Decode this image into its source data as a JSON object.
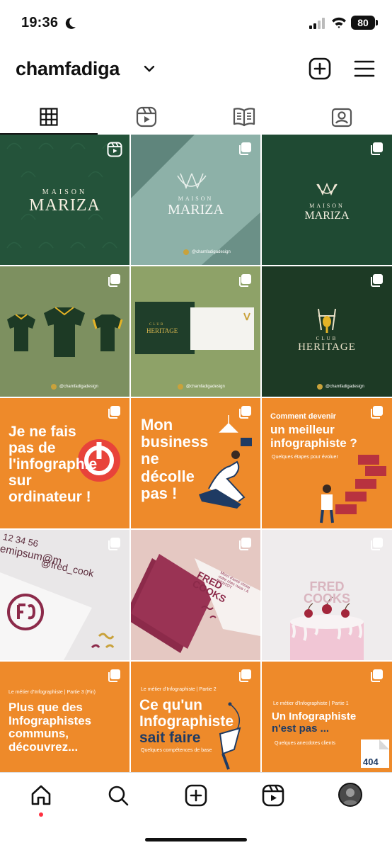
{
  "status_bar": {
    "time": "19:36",
    "battery": "80"
  },
  "profile": {
    "username": "chamfadiga"
  },
  "tabs": [
    {
      "name": "grid-icon",
      "active": true
    },
    {
      "name": "reels-icon",
      "active": false
    },
    {
      "name": "guide-icon",
      "active": false
    },
    {
      "name": "tagged-icon",
      "active": false
    }
  ],
  "posts": {
    "p1": {
      "maison": "MAISON",
      "name": "MARIZA"
    },
    "p2": {
      "maison": "MAISON",
      "name": "MARIZA",
      "credit": "@chamfadigadesign"
    },
    "p3": {
      "maison": "MAISON",
      "name": "MARIZA"
    },
    "p4": {
      "credit": "@chamfadigadesign"
    },
    "p5": {
      "club": "CLUB",
      "name": "HERITAGE",
      "credit": "@chamfadigadesign"
    },
    "p6": {
      "club": "CLUB",
      "name": "HERITAGE",
      "credit": "@chamfadigadesign"
    },
    "p7": {
      "line1": "Je ne fais",
      "line2": "pas de",
      "line3": "l'infographie",
      "line4": "sur",
      "line5": "ordinateur !"
    },
    "p8": {
      "line1": "Mon",
      "line2": "business",
      "line3": "ne",
      "line4": "décolle",
      "line5": "pas !"
    },
    "p9": {
      "line1": "Comment devenir",
      "line2": "un meilleur",
      "line3": "infographiste ?",
      "sub": "Quelques étapes pour évoluer"
    },
    "p10": {
      "line1": "12 34 56",
      "line2": "emipsum@m",
      "line3": "@fred_cook"
    },
    "p11": {
      "brand1": "FRED",
      "brand2": "COOKS",
      "note": "Merci d'avoir choisi notre chez nous ! À BIENTÔT"
    },
    "p12": {
      "brand1": "FRED",
      "brand2": "COOKS"
    },
    "p13": {
      "kicker": "Le métier d'Infographiste | Partie 3 (Fin)",
      "line1": "Plus que des",
      "line2": "Infographistes",
      "line3": "communs,",
      "line4": "découvrez..."
    },
    "p14": {
      "kicker": "Le métier d'Infographiste | Partie 2",
      "line1": "Ce qu'un",
      "line2": "Infographiste",
      "line3": "sait faire",
      "sub": "Quelques compétences de base"
    },
    "p15": {
      "kicker": "Le métier d'Infographiste | Partie 1",
      "line1": "Un Infographiste",
      "line2": "n'est pas ...",
      "sub": "Quelques anecdotes clients",
      "badge": "404"
    }
  },
  "colors": {
    "orange": "#ee8a2a",
    "green": "#24533a",
    "navy": "#1f3b63",
    "accent_red": "#ff3040"
  }
}
